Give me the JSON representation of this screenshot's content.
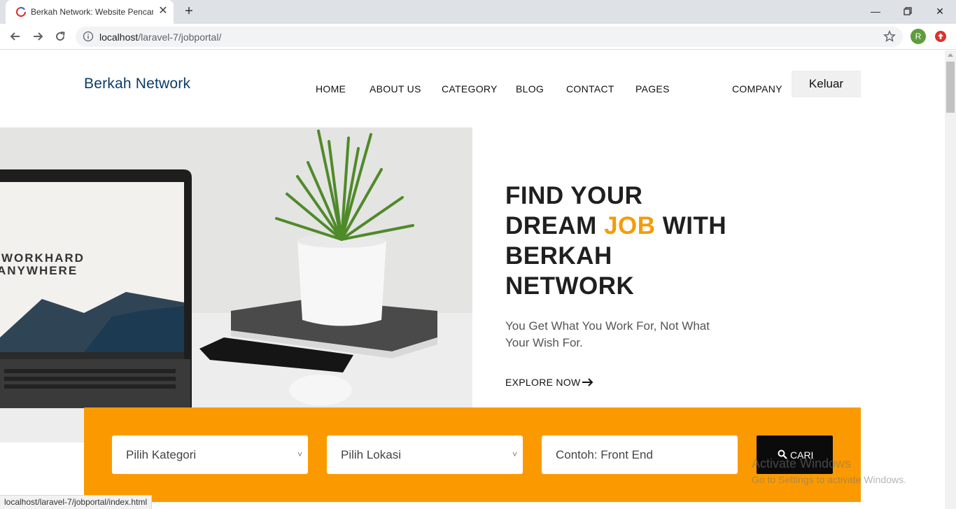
{
  "browser": {
    "tab_title": "Berkah Network: Website Pencari",
    "url_host": "localhost",
    "url_path": "/laravel-7/jobportal/",
    "profile_initial": "R",
    "status_url": "localhost/laravel-7/jobportal/index.html"
  },
  "site": {
    "brand": "Berkah Network",
    "menu": [
      "HOME",
      "ABOUT US",
      "CATEGORY",
      "BLOG",
      "CONTACT",
      "PAGES",
      "COMPANY"
    ],
    "logout_label": "Keluar"
  },
  "hero": {
    "title_line1": "FIND YOUR",
    "title_dream": "DREAM ",
    "title_job": "JOB",
    "title_with": " WITH",
    "title_line3": "BERKAH",
    "title_line4": "NETWORK",
    "subtitle": "You Get What You Work For, Not What Your Wish For.",
    "explore_label": "EXPLORE NOW",
    "laptop_text_1": "WORKHARD",
    "laptop_text_2": "ANYWHERE"
  },
  "search": {
    "category_placeholder": "Pilih Kategori",
    "location_placeholder": "Pilih Lokasi",
    "keyword_placeholder": "Contoh: Front End",
    "button_label": "CARI"
  },
  "watermark": {
    "line1": "Activate Windows",
    "line2": "Go to Settings to activate Windows."
  },
  "colors": {
    "accent": "#fb9a00",
    "accent_text": "#f59c09",
    "brand": "#0d3b66"
  }
}
